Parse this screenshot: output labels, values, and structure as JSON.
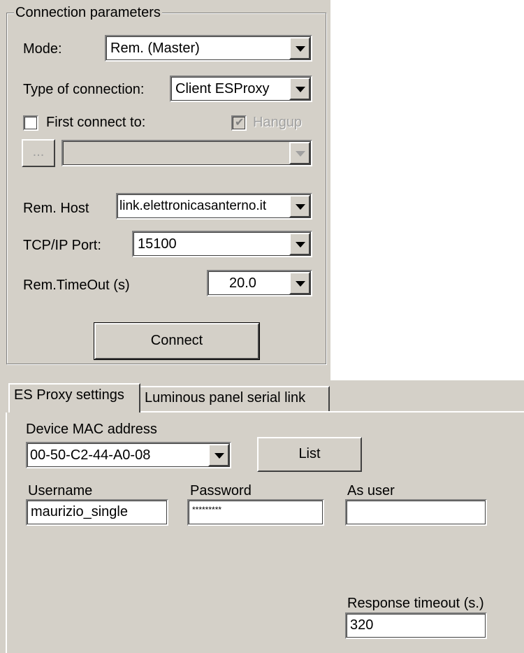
{
  "connection": {
    "group_title": "Connection parameters",
    "mode": {
      "label": "Mode:",
      "value": "Rem. (Master)"
    },
    "type_of_connection": {
      "label": "Type of connection:",
      "value": "Client ESProxy"
    },
    "first_connect": {
      "label": "First connect to:",
      "checked": false,
      "browse_label": "...",
      "value": ""
    },
    "hangup": {
      "label": "Hangup",
      "checked": true,
      "enabled": false
    },
    "rem_host": {
      "label": "Rem. Host",
      "value": "link.elettronicasanterno.it"
    },
    "tcp_port": {
      "label": "TCP/IP Port:",
      "value": "15100"
    },
    "rem_timeout": {
      "label": "Rem.TimeOut (s)",
      "value": "20.0"
    },
    "connect_button": "Connect"
  },
  "tabs": [
    {
      "label": "ES Proxy settings",
      "active": true
    },
    {
      "label": "Luminous panel serial link",
      "active": false
    }
  ],
  "esproxy": {
    "mac": {
      "label": "Device MAC address",
      "value": "00-50-C2-44-A0-08"
    },
    "list_button": "List",
    "username": {
      "label": "Username",
      "value": "maurizio_single"
    },
    "password": {
      "label": "Password",
      "value": "*********"
    },
    "as_user": {
      "label": "As user",
      "value": ""
    },
    "response_timeout": {
      "label": "Response timeout (s.)",
      "value": "320"
    }
  },
  "colors": {
    "window_background": "#d4d0c8",
    "disabled_text": "#a0a0a0"
  }
}
